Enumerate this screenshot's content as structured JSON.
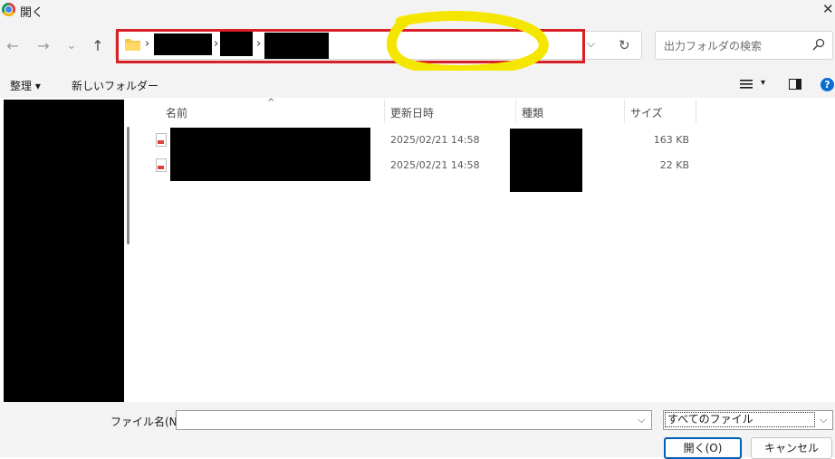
{
  "window": {
    "title": "開く",
    "close_glyph": "✕"
  },
  "nav": {
    "back_glyph": "←",
    "forward_glyph": "→",
    "recent_glyph": "⌄",
    "up_glyph": "↑",
    "address_dropdown_glyph": "⌵",
    "refresh_glyph": "↻",
    "breadcrumb_separator": "›"
  },
  "search": {
    "placeholder": "出力フォルダの検索"
  },
  "toolbar": {
    "organize_label": "整理 ▾",
    "new_folder_label": "新しいフォルダー",
    "view_caret": "▾",
    "help_glyph": "?"
  },
  "columns": {
    "sort_caret": "^",
    "name": "名前",
    "date": "更新日時",
    "type": "種類",
    "size": "サイズ"
  },
  "files": [
    {
      "date": "2025/02/21 14:58",
      "size": "163 KB"
    },
    {
      "date": "2025/02/21 14:58",
      "size": "22 KB"
    }
  ],
  "bottom": {
    "filename_label": "ファイル名(N):",
    "filename_value": "",
    "dropdown_glyph": "⌵",
    "filter_value": "すべてのファイル",
    "open_label": "開く(O)",
    "cancel_label": "キャンセル"
  },
  "colors": {
    "accent": "#005fb8",
    "highlight_red": "#d81f26",
    "marker_yellow": "#f5e600",
    "chrome_bg": "#f3f3f3"
  }
}
